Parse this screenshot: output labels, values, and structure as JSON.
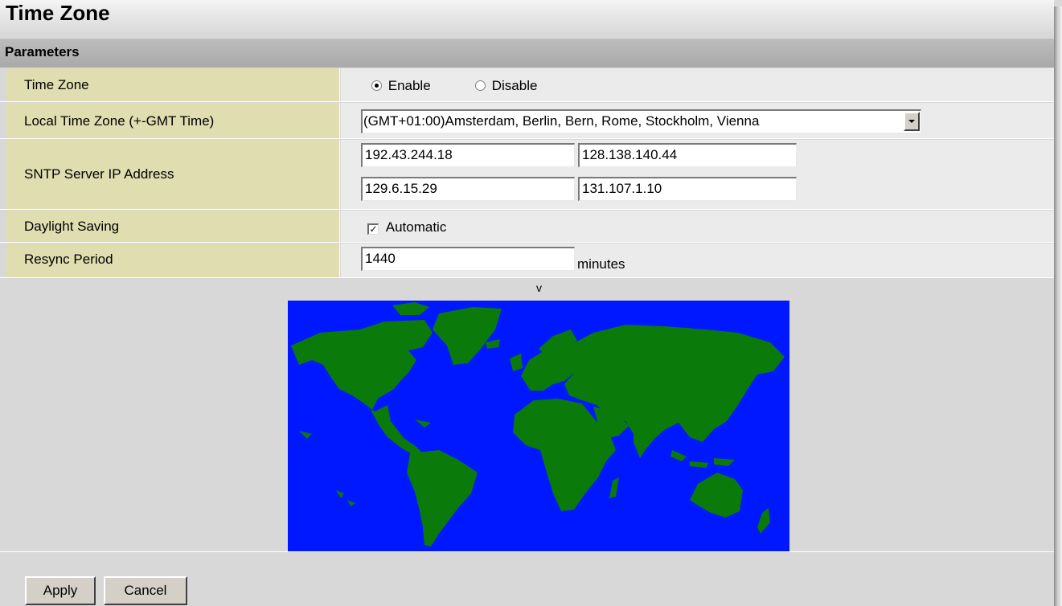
{
  "page": {
    "title": "Time Zone",
    "section": "Parameters"
  },
  "fields": {
    "time_zone": {
      "label": "Time Zone",
      "options": [
        "Enable",
        "Disable"
      ],
      "selected": "Enable"
    },
    "local_time_zone": {
      "label": "Local Time Zone (+-GMT Time)",
      "value": "(GMT+01:00)Amsterdam, Berlin, Bern, Rome, Stockholm, Vienna"
    },
    "sntp": {
      "label": "SNTP Server IP Address",
      "servers": [
        "192.43.244.18",
        "128.138.140.44",
        "129.6.15.29",
        "131.107.1.10"
      ]
    },
    "daylight_saving": {
      "label": "Daylight Saving",
      "option": "Automatic",
      "checked": true
    },
    "resync": {
      "label": "Resync Period",
      "value": "1440",
      "unit": "minutes"
    }
  },
  "map": {
    "marker": "v",
    "ocean_color": "#0018ff",
    "land_color": "#0a7a0a"
  },
  "buttons": {
    "apply": "Apply",
    "cancel": "Cancel"
  }
}
